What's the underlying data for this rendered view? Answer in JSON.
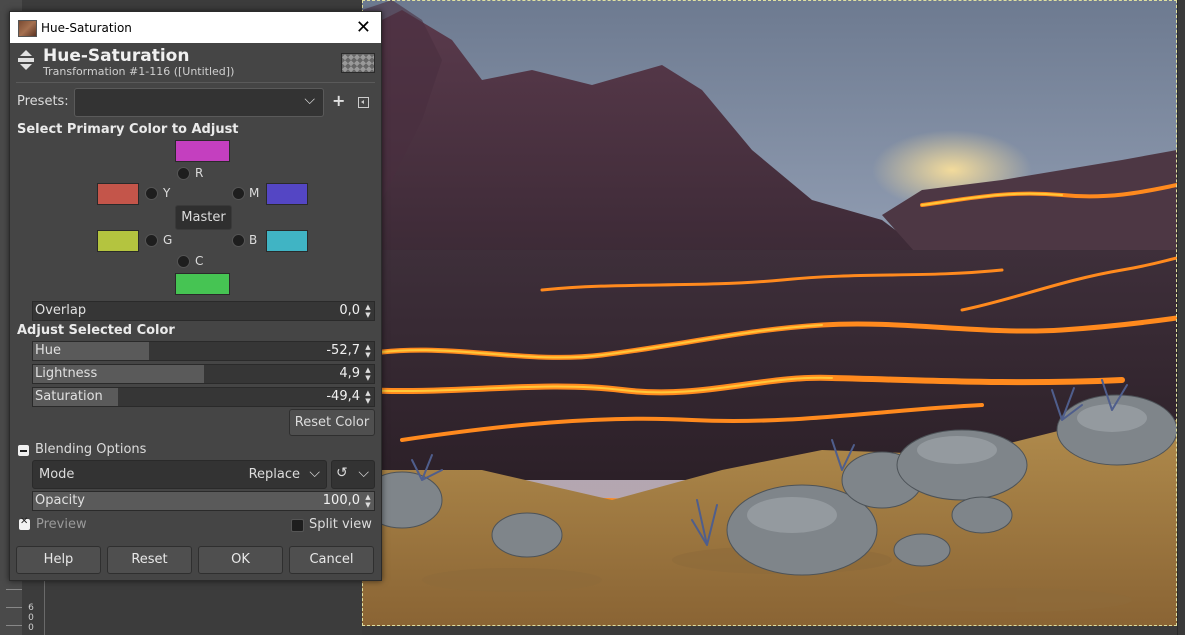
{
  "ruler": {
    "digits": [
      "6",
      "0",
      "0"
    ]
  },
  "dialog": {
    "window_title": "Hue-Saturation",
    "close_glyph": "✕",
    "header_title": "Hue-Saturation",
    "header_subtitle": "Transformation #1-116 ([Untitled])",
    "presets_label": "Presets:",
    "presets_value": "",
    "primary_color_heading": "Select Primary Color to Adjust",
    "colors": {
      "R": {
        "label": "R",
        "swatch": "#c43fbf"
      },
      "Y": {
        "label": "Y",
        "swatch": "#c4554a"
      },
      "M": {
        "label": "M",
        "swatch": "#5446c4"
      },
      "G": {
        "label": "G",
        "swatch": "#b4c43f"
      },
      "B": {
        "label": "B",
        "swatch": "#40b4c4"
      },
      "C": {
        "label": "C",
        "swatch": "#46c453"
      }
    },
    "master_label": "Master",
    "overlap": {
      "label": "Overlap",
      "value": "0,0",
      "fraction": 0.0
    },
    "adjust_heading": "Adjust Selected Color",
    "hue": {
      "label": "Hue",
      "value": "-52,7",
      "fraction": 0.34
    },
    "lightness": {
      "label": "Lightness",
      "value": "4,9",
      "fraction": 0.5
    },
    "saturation": {
      "label": "Saturation",
      "value": "-49,4",
      "fraction": 0.25
    },
    "reset_color_label": "Reset Color",
    "blending_options_label": "Blending Options",
    "mode_label": "Mode",
    "mode_value": "Replace",
    "opacity": {
      "label": "Opacity",
      "value": "100,0",
      "fraction": 1.0
    },
    "preview_label": "Preview",
    "preview_checked": true,
    "split_view_label": "Split view",
    "split_view_checked": false,
    "buttons": {
      "help": "Help",
      "reset": "Reset",
      "ok": "OK",
      "cancel": "Cancel"
    }
  }
}
